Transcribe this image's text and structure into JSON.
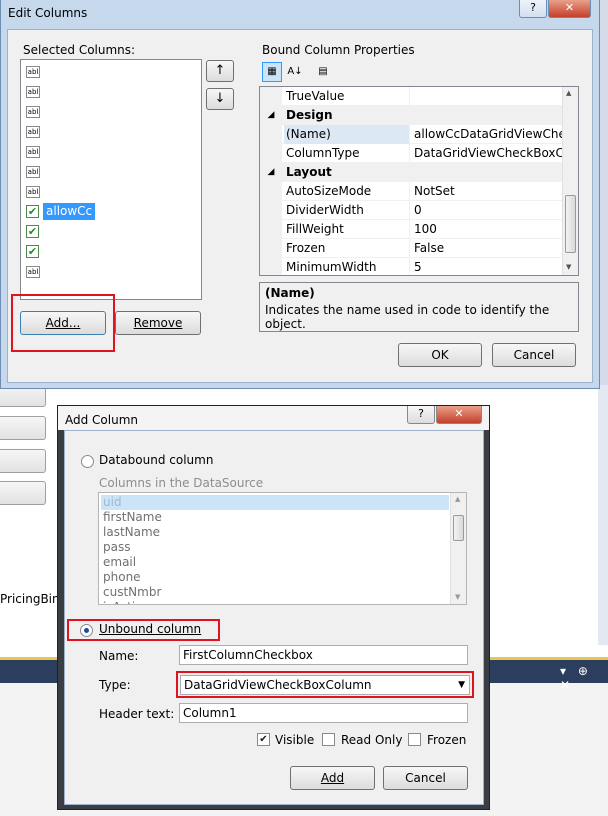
{
  "edit_columns": {
    "title": "Edit Columns",
    "help_button": "?",
    "close_button": "✕",
    "selected_columns_label": "Selected Columns:",
    "columns": [
      {
        "kind": "text",
        "label": ""
      },
      {
        "kind": "text",
        "label": ""
      },
      {
        "kind": "text",
        "label": ""
      },
      {
        "kind": "text",
        "label": ""
      },
      {
        "kind": "text",
        "label": ""
      },
      {
        "kind": "text",
        "label": ""
      },
      {
        "kind": "text",
        "label": ""
      },
      {
        "kind": "check",
        "label": "allowCc"
      },
      {
        "kind": "check",
        "label": ""
      },
      {
        "kind": "check",
        "label": ""
      },
      {
        "kind": "text",
        "label": ""
      }
    ],
    "abl_glyph": "abl",
    "check_glyph": "✔",
    "move_up": "↑",
    "move_down": "↓",
    "add_button": "Add...",
    "remove_button": "Remove",
    "bound_properties_label": "Bound Column Properties",
    "property_rows": [
      {
        "type": "prop",
        "name": "TrueValue",
        "value": ""
      },
      {
        "type": "cat",
        "name": "Design"
      },
      {
        "type": "prop",
        "name": "(Name)",
        "value": "allowCcDataGridViewCheck",
        "selected": true
      },
      {
        "type": "prop",
        "name": "ColumnType",
        "value": "DataGridViewCheckBoxColu"
      },
      {
        "type": "cat",
        "name": "Layout"
      },
      {
        "type": "prop",
        "name": "AutoSizeMode",
        "value": "NotSet"
      },
      {
        "type": "prop",
        "name": "DividerWidth",
        "value": "0"
      },
      {
        "type": "prop",
        "name": "FillWeight",
        "value": "100"
      },
      {
        "type": "prop",
        "name": "Frozen",
        "value": "False"
      },
      {
        "type": "prop",
        "name": "MinimumWidth",
        "value": "5"
      }
    ],
    "description_title": "(Name)",
    "description_text": "Indicates the name used in code to identify the object.",
    "ok_button": "OK",
    "cancel_button": "Cancel"
  },
  "add_column": {
    "title": "Add Column",
    "help_button": "?",
    "close_button": "✕",
    "databound_label": "Databound column",
    "datasource_label": "Columns in the DataSource",
    "datasource_items": [
      "uid",
      "firstName",
      "lastName",
      "pass",
      "email",
      "phone",
      "custNmbr",
      "isActive"
    ],
    "unbound_label": "Unbound column",
    "name_label": "Name:",
    "name_value": "FirstColumnCheckbox",
    "type_label": "Type:",
    "type_value": "DataGridViewCheckBoxColumn",
    "header_label": "Header text:",
    "header_value": "Column1",
    "visible_label": "Visible",
    "readonly_label": "Read Only",
    "frozen_label": "Frozen",
    "add_button": "Add",
    "cancel_button": "Cancel"
  },
  "background": {
    "pricing_text": "PricingBind",
    "toolwindow_glyphs": "▾ ⊕ ✕"
  },
  "colors": {
    "selection": "#3399ff",
    "highlight_border": "#e0141e",
    "title_frame": "#c5d8ec"
  }
}
